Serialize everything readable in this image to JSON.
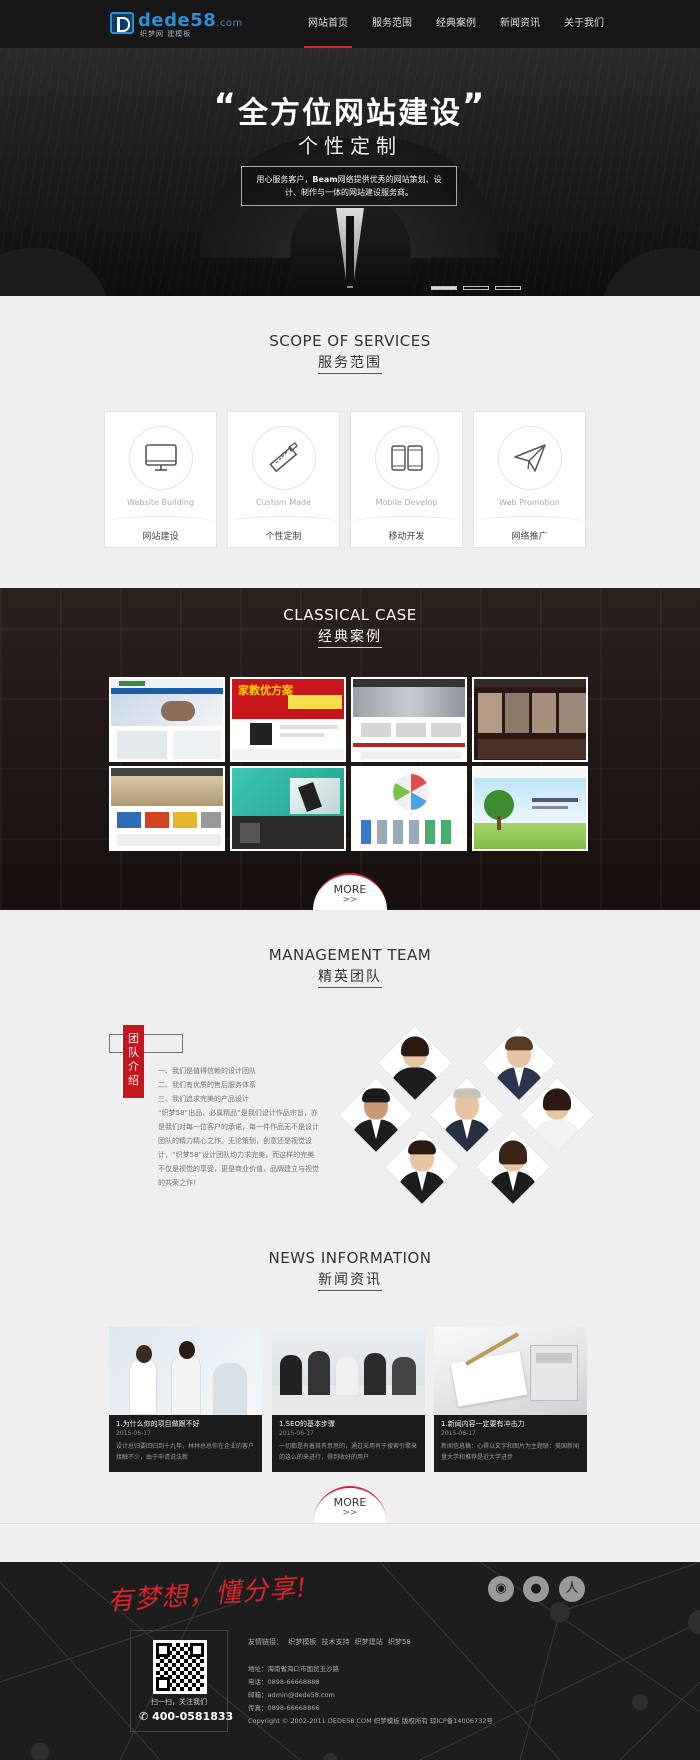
{
  "brand": {
    "name_a": "dede",
    "name_b": "58",
    "domain": ".com",
    "tagline": "织梦网 建模板"
  },
  "nav": {
    "items": [
      {
        "label": "网站首页",
        "active": true
      },
      {
        "label": "服务范围",
        "active": false
      },
      {
        "label": "经典案例",
        "active": false
      },
      {
        "label": "新闻资讯",
        "active": false
      },
      {
        "label": "关于我们",
        "active": false
      }
    ]
  },
  "hero": {
    "quote_open": "“",
    "title": "全方位网站建设",
    "quote_close": "”",
    "subtitle": "个性定制",
    "desc_a": "用心服务客户，",
    "desc_brand": "Beam",
    "desc_b": "网络提供优秀的网站策划、设计、制作与一体的网站建设服务商。",
    "slides": 3,
    "active_slide": 1
  },
  "services": {
    "title_en": "SCOPE OF SERVICES",
    "title_cn": "服务范围",
    "items": [
      {
        "en": "Website Building",
        "cn": "网站建设",
        "icon": "monitor-icon"
      },
      {
        "en": "Custom Made",
        "cn": "个性定制",
        "icon": "ruler-pencil-icon"
      },
      {
        "en": "Mobile Develop",
        "cn": "移动开发",
        "icon": "mobile-tablet-icon"
      },
      {
        "en": "Web Promotion",
        "cn": "网络推广",
        "icon": "paper-plane-icon"
      }
    ]
  },
  "cases": {
    "title_en": "CLASSICAL CASE",
    "title_cn": "经典案例",
    "thumb_text_2": "家教优方案",
    "more": "MORE",
    "more_arrow": ">>"
  },
  "team": {
    "title_en": "MANAGEMENT TEAM",
    "title_cn": "精英团队",
    "label": "团队介绍",
    "list": [
      "一、我们是值得信赖的设计团队",
      "二、我们有优质的售后服务体系",
      "三、我们追求完美的产品设计"
    ],
    "desc": "“织梦58”出品，必属精品”是我们设计作品宗旨，亦是我们对每一位客户的承诺，每一件作品无不是设计团队的精力精心之作。无论策划，创意还是视觉设计，“织梦58”设计团队均力求完美，而这样的完美不仅是视觉的享受，更是商业价值，品牌建立与视觉的共荣之作！"
  },
  "news": {
    "title_en": "NEWS INFORMATION",
    "title_cn": "新闻资讯",
    "items": [
      {
        "title": "1.为什么你的项目做跟不好",
        "date": "2015-06-17",
        "excerpt": "设计总归要回归到十九年，林林总总你在企业的客户接触不少，由于申请说法新"
      },
      {
        "title": "1.SEO的基本步骤",
        "date": "2015-06-17",
        "excerpt": "一切都是有着其有意思的，通过采用有于搜索引擎来的这么的来进行，得到收好的用户"
      },
      {
        "title": "1.新闻内容一定要有冲击力",
        "date": "2015-06-17",
        "excerpt": "新闻信息稿：心得以文字和图片为主题联：美国新闻量大学和推荐是近大学进步"
      }
    ],
    "more": "MORE",
    "more_arrow": ">>"
  },
  "footer": {
    "slogan": "有梦想，懂分享!",
    "social": [
      {
        "icon": "weibo-icon",
        "glyph": "◉"
      },
      {
        "icon": "qq-icon",
        "glyph": "●"
      },
      {
        "icon": "person-icon",
        "glyph": "人"
      }
    ],
    "qr_caption": "扫一扫，关注我们",
    "phone_glyph": "✆",
    "phone": "400-0581833",
    "links_label": "友情链接：",
    "links": [
      "织梦模板",
      "技术支持",
      "织梦建站",
      "织梦58"
    ],
    "address": "地址：海南省海口市国贸玉沙路",
    "tel": "电话：0898-66668888",
    "email": "邮箱：admin@dede58.com",
    "fax": "传真：0898-66668866",
    "copyright": "Copyright © 2002-2011 DEDE58.COM 织梦模板 版权所有  琼ICP备14006732号"
  },
  "colors": {
    "accent": "#d9252c",
    "header_bg": "#161616",
    "footer_bg": "#1d1d1d",
    "brand_blue": "#2a8fd6"
  }
}
